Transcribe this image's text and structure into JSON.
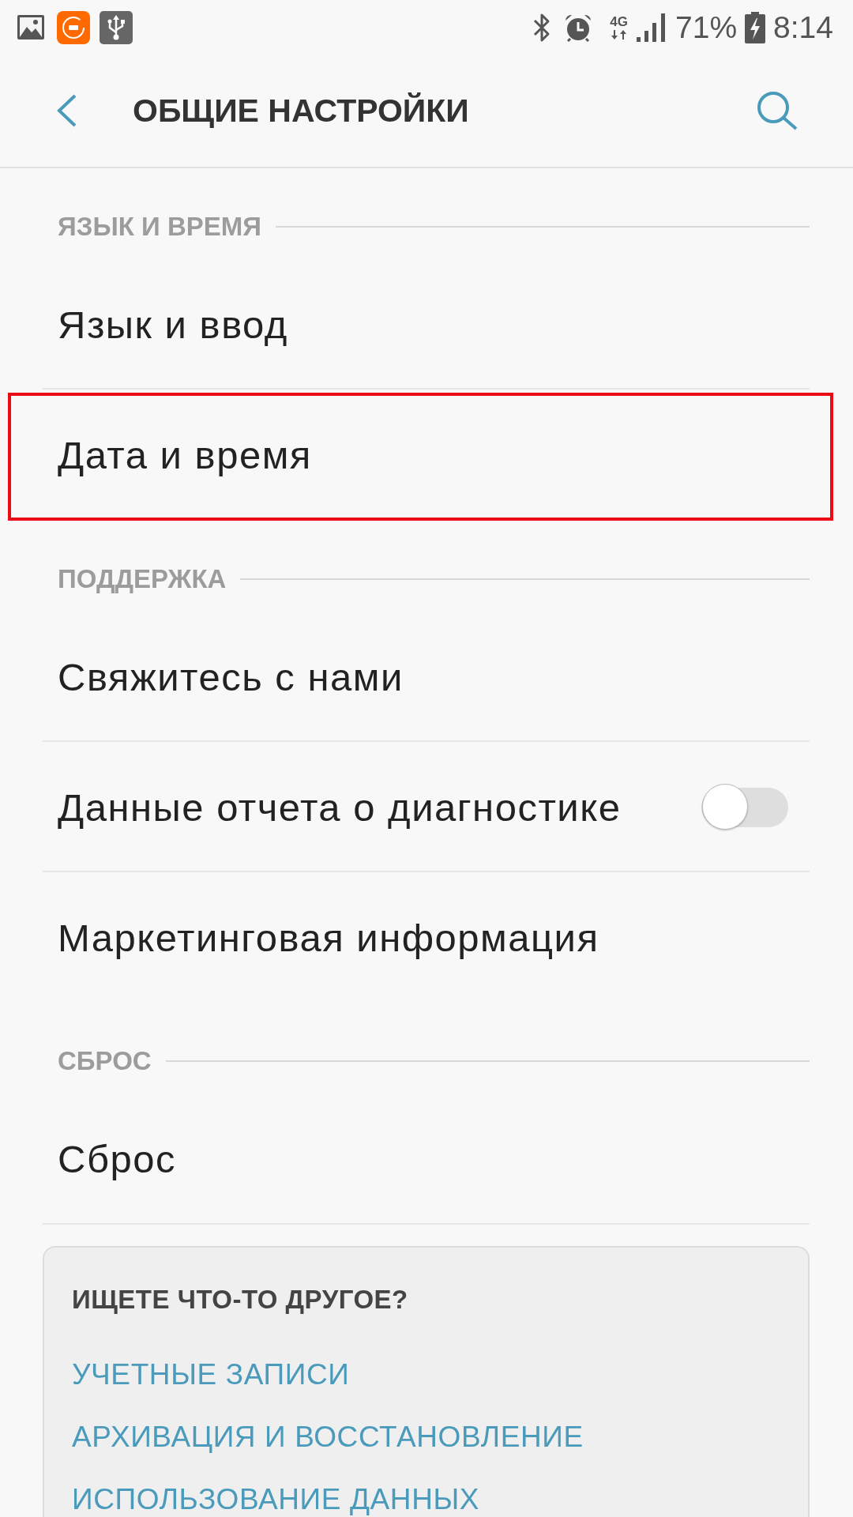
{
  "status_bar": {
    "network": "4G",
    "battery": "71%",
    "time": "8:14"
  },
  "header": {
    "title": "ОБЩИЕ НАСТРОЙКИ"
  },
  "sections": [
    {
      "title": "ЯЗЫК И ВРЕМЯ",
      "items": [
        {
          "label": "Язык и ввод",
          "kind": "link",
          "highlighted": false
        },
        {
          "label": "Дата и время",
          "kind": "link",
          "highlighted": true
        }
      ]
    },
    {
      "title": "ПОДДЕРЖКА",
      "items": [
        {
          "label": "Свяжитесь с нами",
          "kind": "link",
          "highlighted": false
        },
        {
          "label": "Данные отчета о диагностике",
          "kind": "switch",
          "on": false,
          "highlighted": false
        },
        {
          "label": "Маркетинговая информация",
          "kind": "link",
          "highlighted": false
        }
      ]
    },
    {
      "title": "СБРОС",
      "items": [
        {
          "label": "Сброс",
          "kind": "link",
          "highlighted": false
        }
      ]
    }
  ],
  "suggestions": {
    "title": "ИЩЕТЕ ЧТО-ТО ДРУГОЕ?",
    "links": [
      "УЧЕТНЫЕ ЗАПИСИ",
      "АРХИВАЦИЯ И ВОССТАНОВЛЕНИЕ",
      "ИСПОЛЬЗОВАНИЕ ДАННЫХ"
    ]
  }
}
